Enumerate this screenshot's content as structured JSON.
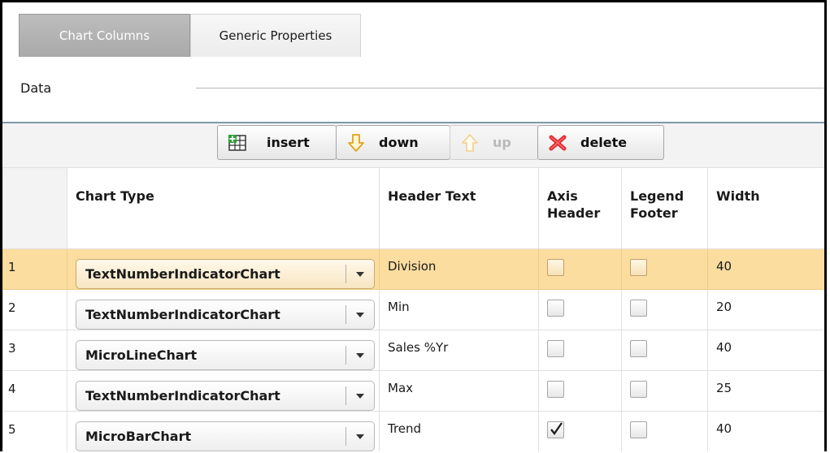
{
  "tabs": [
    {
      "label": "Chart Columns",
      "active": true
    },
    {
      "label": "Generic Properties",
      "active": false
    }
  ],
  "section": {
    "title": "Data"
  },
  "toolbar": {
    "insert_label": "insert",
    "down_label": "down",
    "up_label": "up",
    "delete_label": "delete",
    "icons": [
      "table-add-icon",
      "arrow-down-icon",
      "arrow-up-icon",
      "delete-x-icon"
    ]
  },
  "grid": {
    "columns": [
      "",
      "Chart Type",
      "Header Text",
      "Axis Header",
      "Legend Footer",
      "Width"
    ],
    "rows": [
      {
        "num": "1",
        "chart_type": "TextNumberIndicatorChart",
        "header_text": "Division",
        "axis_header": false,
        "legend_footer": false,
        "width": "40",
        "selected": true
      },
      {
        "num": "2",
        "chart_type": "TextNumberIndicatorChart",
        "header_text": "Min",
        "axis_header": false,
        "legend_footer": false,
        "width": "20",
        "selected": false
      },
      {
        "num": "3",
        "chart_type": "MicroLineChart",
        "header_text": "Sales %Yr",
        "axis_header": false,
        "legend_footer": false,
        "width": "40",
        "selected": false
      },
      {
        "num": "4",
        "chart_type": "TextNumberIndicatorChart",
        "header_text": "Max",
        "axis_header": false,
        "legend_footer": false,
        "width": "25",
        "selected": false
      },
      {
        "num": "5",
        "chart_type": "MicroBarChart",
        "header_text": "Trend",
        "axis_header": true,
        "legend_footer": false,
        "width": "40",
        "selected": false
      }
    ]
  },
  "colors": {
    "selected_row": "#fbdda0",
    "tab_active": "#b3b3b3",
    "section_rule": "#7d98a8",
    "delete_icon": "#e0262e",
    "insert_icon": "#2e9e3a",
    "arrow_icon": "#e3a21a"
  }
}
